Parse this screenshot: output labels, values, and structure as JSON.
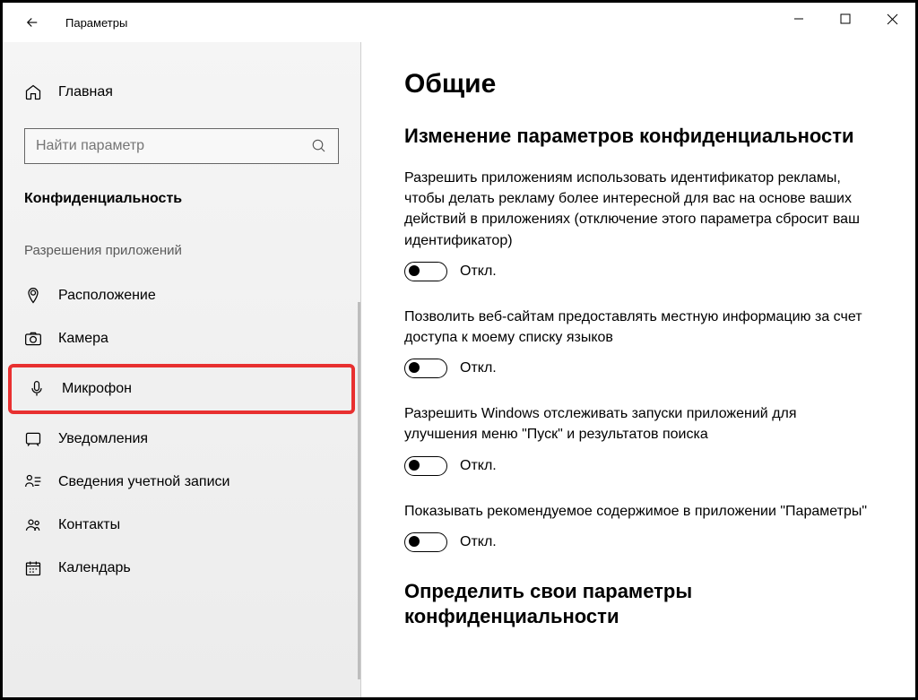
{
  "window": {
    "title": "Параметры"
  },
  "sidebar": {
    "home": "Главная",
    "search_placeholder": "Найти параметр",
    "category": "Конфиденциальность",
    "section": "Разрешения приложений",
    "items": [
      {
        "label": "Расположение"
      },
      {
        "label": "Камера"
      },
      {
        "label": "Микрофон"
      },
      {
        "label": "Уведомления"
      },
      {
        "label": "Сведения учетной записи"
      },
      {
        "label": "Контакты"
      },
      {
        "label": "Календарь"
      }
    ]
  },
  "main": {
    "title": "Общие",
    "subtitle": "Изменение параметров конфиденциальности",
    "settings": [
      {
        "text": "Разрешить приложениям использовать идентификатор рекламы, чтобы делать рекламу более интересной для вас на основе ваших действий в приложениях (отключение этого параметра сбросит ваш идентификатор)",
        "state": "Откл."
      },
      {
        "text": "Позволить веб-сайтам предоставлять местную информацию за счет доступа к моему списку языков",
        "state": "Откл."
      },
      {
        "text": "Разрешить Windows отслеживать запуски приложений для улучшения меню \"Пуск\" и результатов поиска",
        "state": "Откл."
      },
      {
        "text": "Показывать рекомендуемое содержимое в приложении \"Параметры\"",
        "state": "Откл."
      }
    ],
    "subtitle2": "Определить свои параметры конфиденциальности"
  }
}
